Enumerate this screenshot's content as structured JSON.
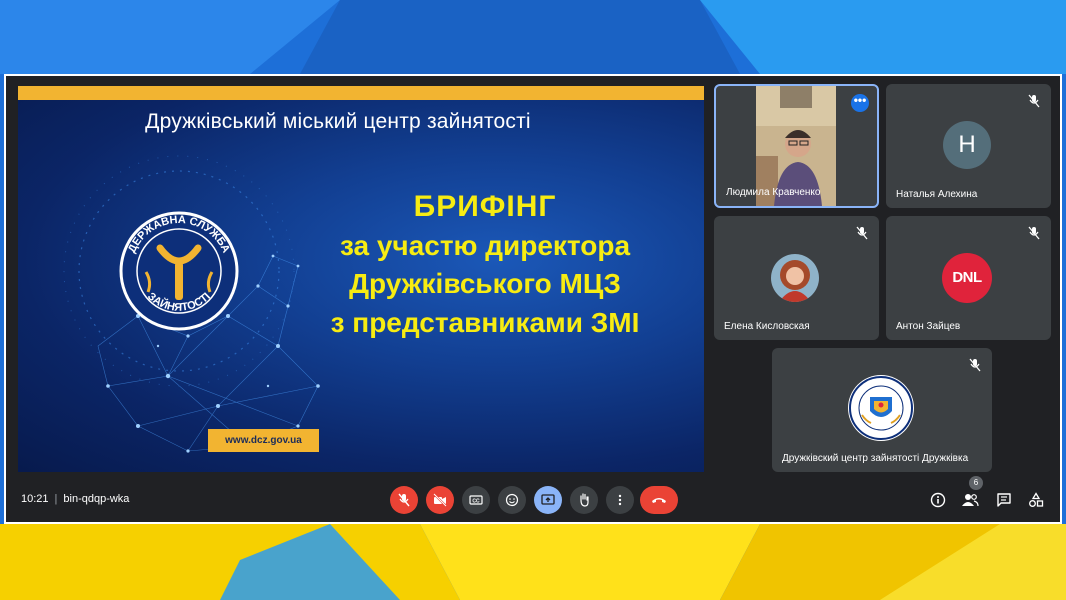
{
  "slide": {
    "org_name": "Дружківський міський центр зайнятості",
    "title_lines": [
      "БРИФІНГ",
      "за участю директора",
      "Дружківського МЦЗ",
      "з  представниками ЗМІ"
    ],
    "url": "www.dcz.gov.ua",
    "logo_top": "ДЕРЖАВНА СЛУЖБА",
    "logo_bottom": "ЗАЙНЯТОСТІ"
  },
  "participants": [
    {
      "name": "Людмила Кравченко",
      "avatar": "video-feed",
      "muted": false,
      "active": true
    },
    {
      "name": "Наталья Алехина",
      "avatar": "letter",
      "initial": "H",
      "muted": true
    },
    {
      "name": "Елена Кисловская",
      "avatar": "photo",
      "muted": true
    },
    {
      "name": "Антон Зайцев",
      "avatar": "logo",
      "logo_text": "DNL",
      "muted": true
    },
    {
      "name": "Дружківский центр зайнятості Дружківка",
      "avatar": "seal",
      "muted": true
    }
  ],
  "meeting": {
    "time": "10:21",
    "code": "bin-qdqp-wka",
    "participant_count": "6"
  },
  "controls": [
    {
      "name": "mic-off-button",
      "icon": "mic-off-icon"
    },
    {
      "name": "camera-off-button",
      "icon": "camera-off-icon"
    },
    {
      "name": "captions-button",
      "icon": "captions-icon"
    },
    {
      "name": "reactions-button",
      "icon": "smiley-icon"
    },
    {
      "name": "present-button",
      "icon": "present-icon"
    },
    {
      "name": "raise-hand-button",
      "icon": "hand-icon"
    },
    {
      "name": "more-options-button",
      "icon": "more-vert-icon"
    },
    {
      "name": "leave-call-button",
      "icon": "hangup-icon"
    }
  ],
  "colors": {
    "accent_blue": "#8ab4f8",
    "danger": "#ea4335",
    "slide_yellow": "#f7ec12",
    "slide_bar": "#f2b431"
  }
}
